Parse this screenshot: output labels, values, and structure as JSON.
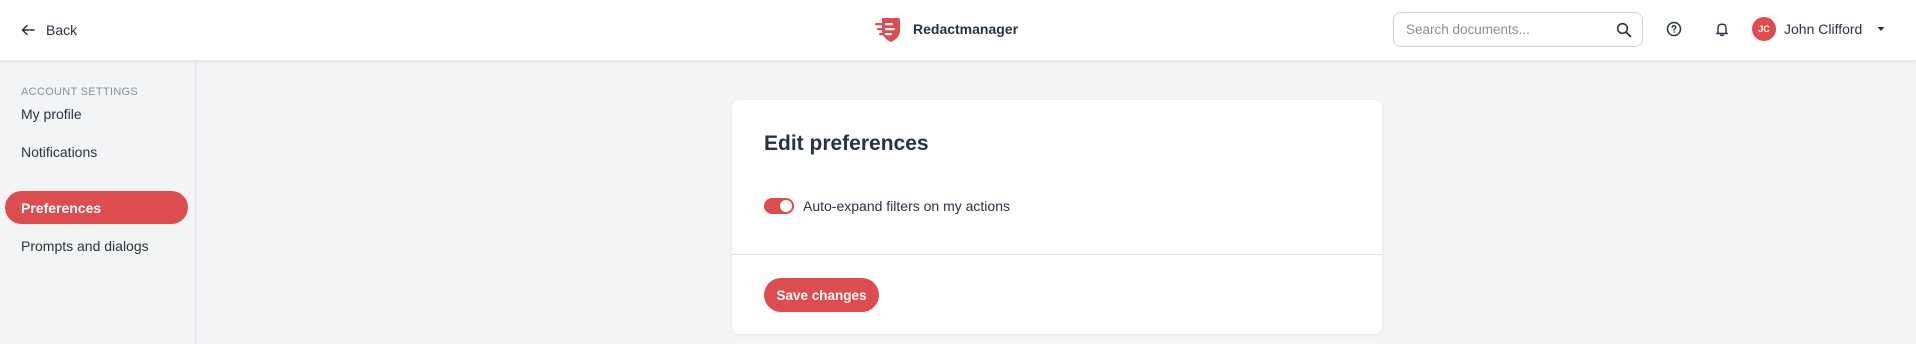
{
  "header": {
    "back_label": "Back",
    "brand_name": "Redactmanager",
    "search_placeholder": "Search documents...",
    "user": {
      "initials": "JC",
      "name": "John Clifford"
    }
  },
  "sidebar": {
    "title": "ACCOUNT SETTINGS",
    "items": [
      {
        "label": "My profile",
        "active": false
      },
      {
        "label": "Notifications",
        "active": false
      },
      {
        "label": "Preferences",
        "active": true
      },
      {
        "label": "Prompts and dialogs",
        "active": false
      }
    ]
  },
  "card": {
    "title": "Edit preferences",
    "preferences": [
      {
        "label": "Auto-expand filters on my actions",
        "enabled": true
      }
    ],
    "save_label": "Save changes"
  },
  "colors": {
    "accent": "#dd4d50",
    "text": "#283241",
    "muted": "#868e98",
    "background": "#f3f4f6"
  },
  "icons": {
    "back": "arrow-left-icon",
    "logo": "shield-logo-icon",
    "search": "magnifier-icon",
    "help": "question-circle-icon",
    "notifications": "bell-icon",
    "user_menu": "caret-down-icon"
  }
}
